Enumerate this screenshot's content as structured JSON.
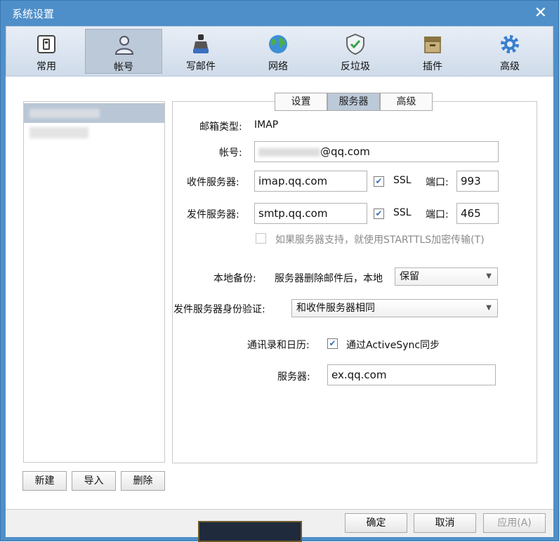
{
  "window": {
    "title": "系统设置",
    "close_glyph": "✕"
  },
  "toolbar": [
    {
      "label": "常用",
      "icon": "general-icon"
    },
    {
      "label": "帐号",
      "icon": "account-icon",
      "active": true
    },
    {
      "label": "写邮件",
      "icon": "compose-icon"
    },
    {
      "label": "网络",
      "icon": "network-icon"
    },
    {
      "label": "反垃圾",
      "icon": "antispam-icon"
    },
    {
      "label": "插件",
      "icon": "plugin-icon"
    },
    {
      "label": "高级",
      "icon": "advanced-icon"
    }
  ],
  "accounts": {
    "buttons": {
      "new": "新建",
      "import": "导入",
      "delete": "删除"
    }
  },
  "tabs": [
    {
      "label": "设置"
    },
    {
      "label": "服务器",
      "active": true
    },
    {
      "label": "高级"
    }
  ],
  "server": {
    "mailbox_type_label": "邮箱类型:",
    "mailbox_type_value": "IMAP",
    "account_label": "帐号:",
    "account_value": "@qq.com",
    "incoming_label": "收件服务器:",
    "incoming_value": "imap.qq.com",
    "incoming_ssl": "SSL",
    "incoming_port_label": "端口:",
    "incoming_port": "993",
    "outgoing_label": "发件服务器:",
    "outgoing_value": "smtp.qq.com",
    "outgoing_ssl": "SSL",
    "outgoing_port_label": "端口:",
    "outgoing_port": "465",
    "starttls_label": "如果服务器支持，就使用STARTTLS加密传输(T)",
    "backup_label": "本地备份:",
    "backup_desc": "服务器删除邮件后，本地",
    "backup_value": "保留",
    "auth_label": "发件服务器身份验证:",
    "auth_value": "和收件服务器相同",
    "sync_label": "通讯录和日历:",
    "sync_option": "通过ActiveSync同步",
    "sync_server_label": "服务器:",
    "sync_server_value": "ex.qq.com"
  },
  "footer": {
    "ok": "确定",
    "cancel": "取消",
    "apply": "应用(A)"
  }
}
